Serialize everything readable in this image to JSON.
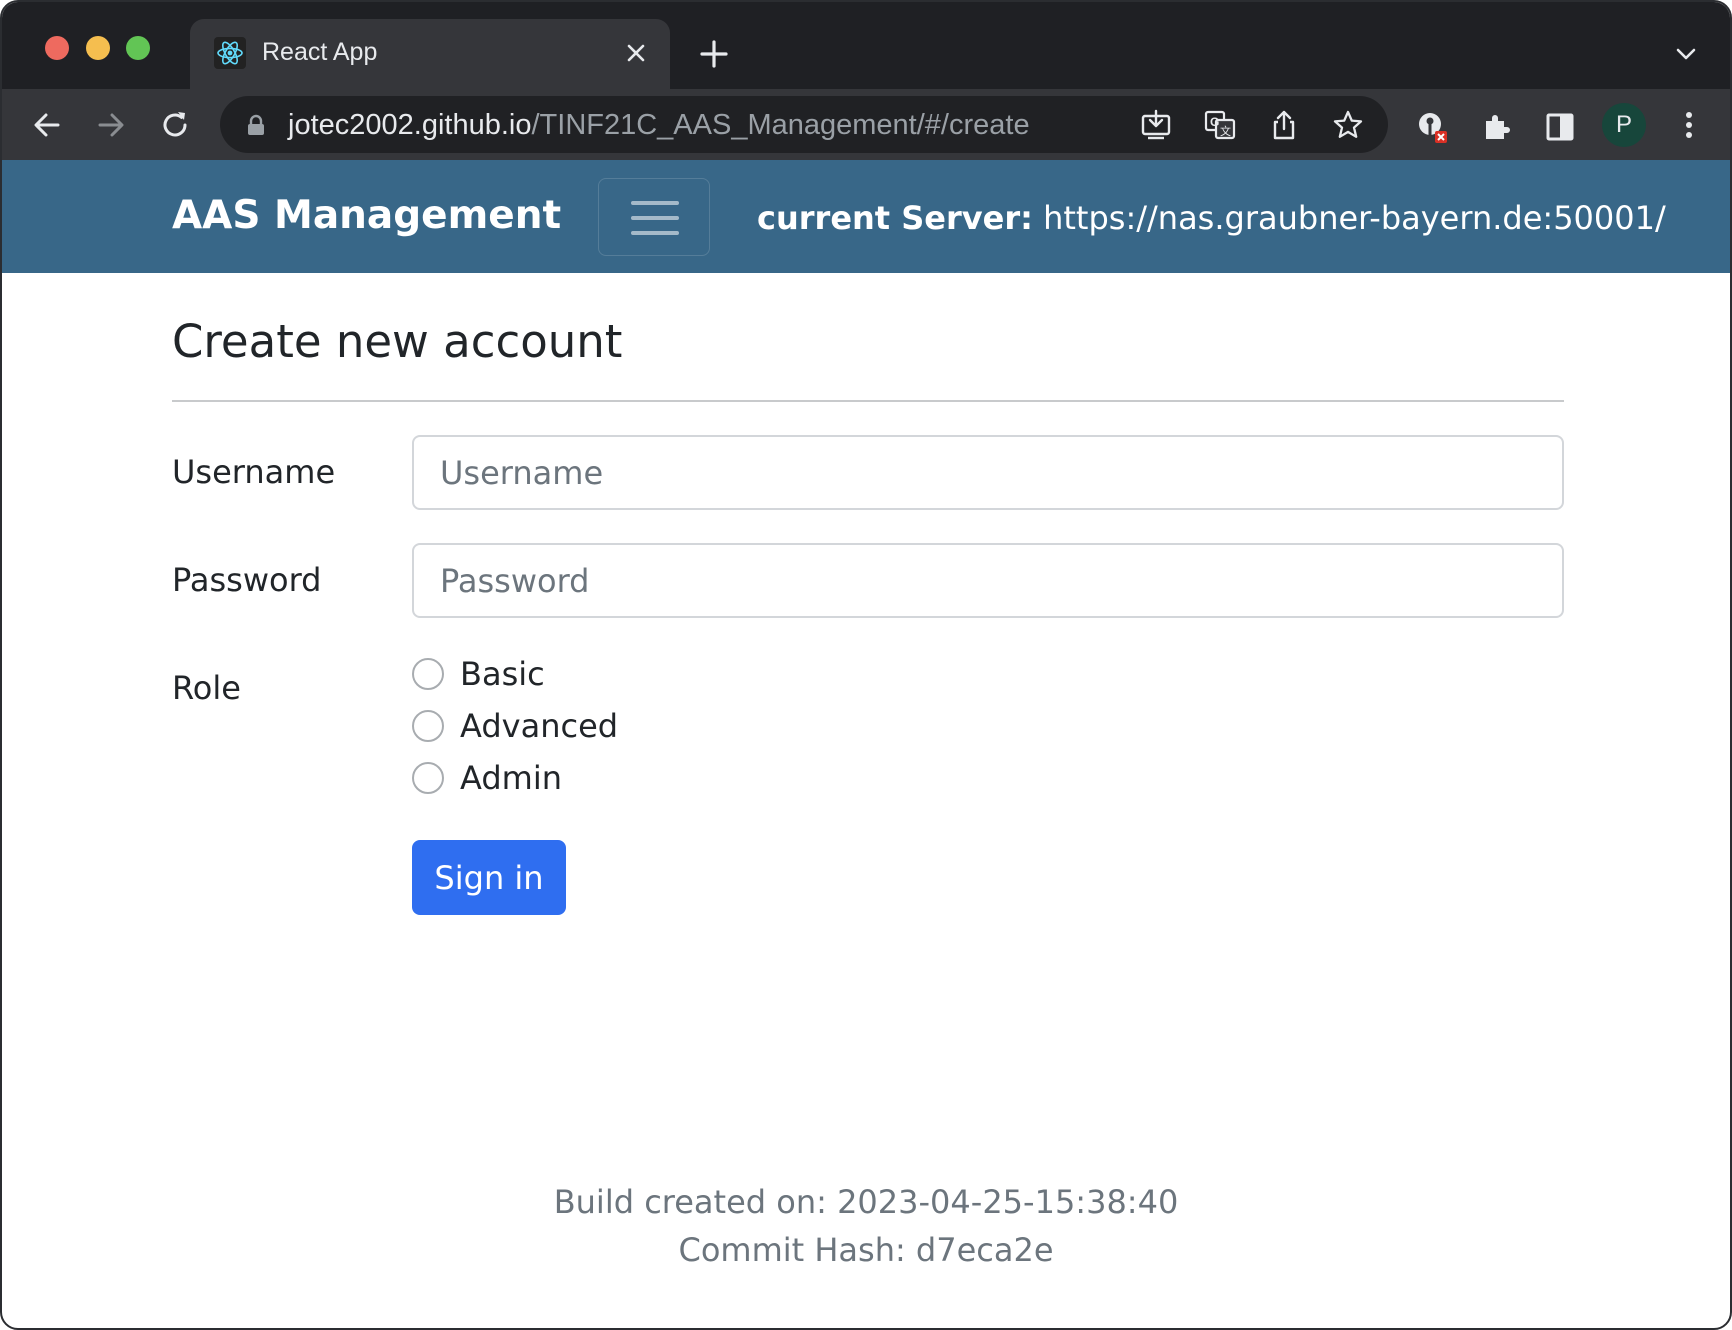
{
  "browser": {
    "tab_title": "React App",
    "url_host": "jotec2002.github.io",
    "url_path": "/TINF21C_AAS_Management/#/create",
    "profile_initial": "P"
  },
  "app": {
    "brand": "AAS Management",
    "server_label": "current Server:",
    "server_url": "https://nas.graubner-bayern.de:50001/"
  },
  "form": {
    "title": "Create new account",
    "username_label": "Username",
    "username_placeholder": "Username",
    "username_value": "",
    "password_label": "Password",
    "password_placeholder": "Password",
    "password_value": "",
    "role_label": "Role",
    "roles": [
      {
        "label": "Basic",
        "selected": false
      },
      {
        "label": "Advanced",
        "selected": false
      },
      {
        "label": "Admin",
        "selected": false
      }
    ],
    "submit_label": "Sign in"
  },
  "footer": {
    "build": "Build created on: 2023-04-25-15:38:40",
    "commit": "Commit Hash: d7eca2e"
  },
  "icons": {
    "tab": "react-logo-icon",
    "tab_close": "close-icon",
    "new_tab": "plus-icon",
    "tab_search": "chevron-down-icon",
    "back": "arrow-left-icon",
    "forward": "arrow-right-icon",
    "reload": "reload-icon",
    "lock": "lock-icon",
    "install": "install-app-icon",
    "translate": "translate-icon",
    "share": "share-icon",
    "bookmark": "star-icon",
    "extension_key": "key-extension-icon",
    "extensions": "puzzle-icon",
    "side_panel": "side-panel-icon",
    "menu": "kebab-menu-icon",
    "nav_toggle": "hamburger-icon"
  },
  "colors": {
    "navbar": "#386788",
    "primary_button": "#2f6ef0",
    "chrome_dark": "#1f2024",
    "chrome_toolbar": "#35363a"
  }
}
